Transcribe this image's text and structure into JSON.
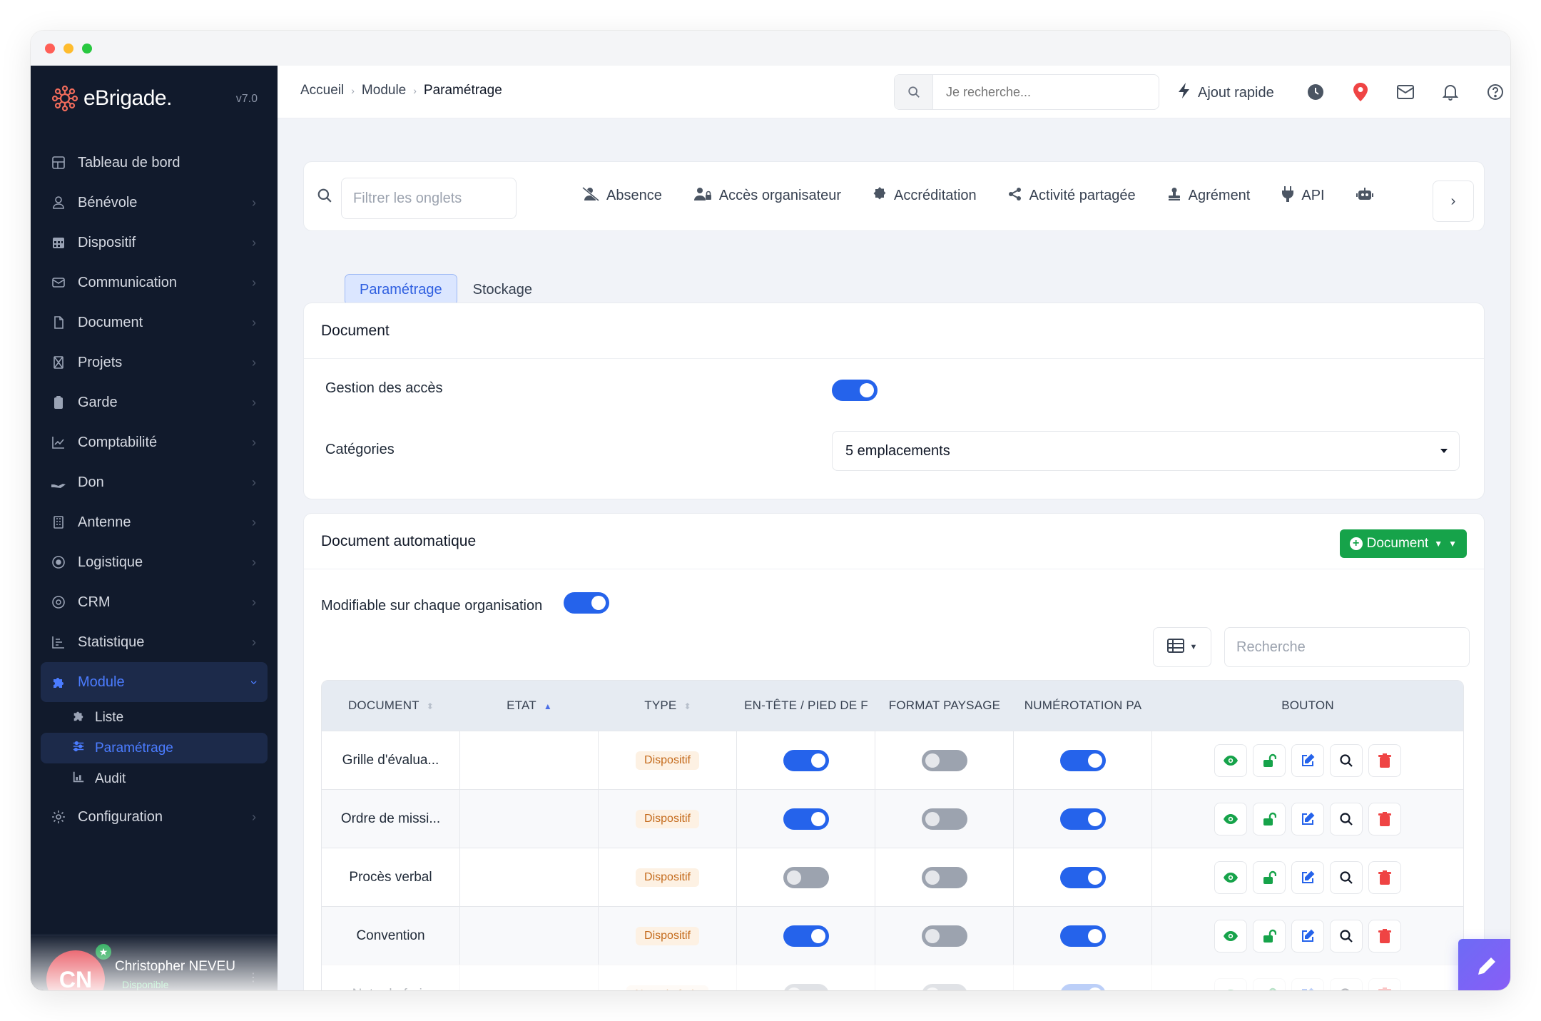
{
  "app": {
    "name": "eBrigade.",
    "version": "v7.0"
  },
  "colors": {
    "sidebar": "#111a2c",
    "accent": "#2563eb",
    "success": "#16a34a",
    "danger": "#ef4444"
  },
  "sidebar": {
    "items": [
      {
        "label": "Tableau de bord",
        "icon": "dashboard-icon"
      },
      {
        "label": "Bénévole",
        "icon": "user-icon"
      },
      {
        "label": "Dispositif",
        "icon": "calendar-icon"
      },
      {
        "label": "Communication",
        "icon": "mail-icon"
      },
      {
        "label": "Document",
        "icon": "file-icon"
      },
      {
        "label": "Projets",
        "icon": "project-icon"
      },
      {
        "label": "Garde",
        "icon": "clipboard-icon"
      },
      {
        "label": "Comptabilité",
        "icon": "chart-icon"
      },
      {
        "label": "Don",
        "icon": "hand-icon"
      },
      {
        "label": "Antenne",
        "icon": "building-icon"
      },
      {
        "label": "Logistique",
        "icon": "circle-dot-icon"
      },
      {
        "label": "CRM",
        "icon": "at-icon"
      },
      {
        "label": "Statistique",
        "icon": "stats-icon"
      },
      {
        "label": "Module",
        "icon": "puzzle-icon"
      }
    ],
    "module_sub": [
      {
        "label": "Liste",
        "icon": "puzzle-icon"
      },
      {
        "label": "Paramétrage",
        "icon": "sliders-icon"
      },
      {
        "label": "Audit",
        "icon": "chart-icon"
      }
    ],
    "config_label": "Configuration"
  },
  "user": {
    "initials": "CN",
    "name": "Christopher NEVEU",
    "status": "Disponible"
  },
  "breadcrumb": [
    "Accueil",
    "Module",
    "Paramétrage"
  ],
  "search": {
    "placeholder": "Je recherche..."
  },
  "quick_add": "Ajout rapide",
  "tabs": {
    "filter_placeholder": "Filtrer les onglets",
    "items": [
      "Absence",
      "Accès organisateur",
      "Accréditation",
      "Activité partagée",
      "Agrément",
      "API"
    ]
  },
  "subtabs": [
    "Paramétrage",
    "Stockage"
  ],
  "document": {
    "title": "Document",
    "access_label": "Gestion des accès",
    "access_on": true,
    "categories_label": "Catégories",
    "categories_value": "5 emplacements"
  },
  "auto_document": {
    "title": "Document automatique",
    "add_button": "Document",
    "modifiable_label": "Modifiable sur chaque organisation",
    "modifiable_on": true,
    "search_placeholder": "Recherche",
    "columns": [
      "Document",
      "Etat",
      "Type",
      "En-tête / pied de f",
      "Format paysage",
      "Numérotation pa",
      "Bouton"
    ],
    "rows": [
      {
        "document": "Grille d'évalua...",
        "etat": "",
        "type": "Dispositif",
        "header": true,
        "landscape": false,
        "numbering": true
      },
      {
        "document": "Ordre de missi...",
        "etat": "",
        "type": "Dispositif",
        "header": true,
        "landscape": false,
        "numbering": true
      },
      {
        "document": "Procès verbal",
        "etat": "",
        "type": "Dispositif",
        "header": false,
        "landscape": false,
        "numbering": true
      },
      {
        "document": "Convention",
        "etat": "",
        "type": "Dispositif",
        "header": true,
        "landscape": false,
        "numbering": true
      },
      {
        "document": "Note de frais",
        "etat": "",
        "type": "Note de frais",
        "header": false,
        "landscape": false,
        "numbering": true
      }
    ]
  }
}
